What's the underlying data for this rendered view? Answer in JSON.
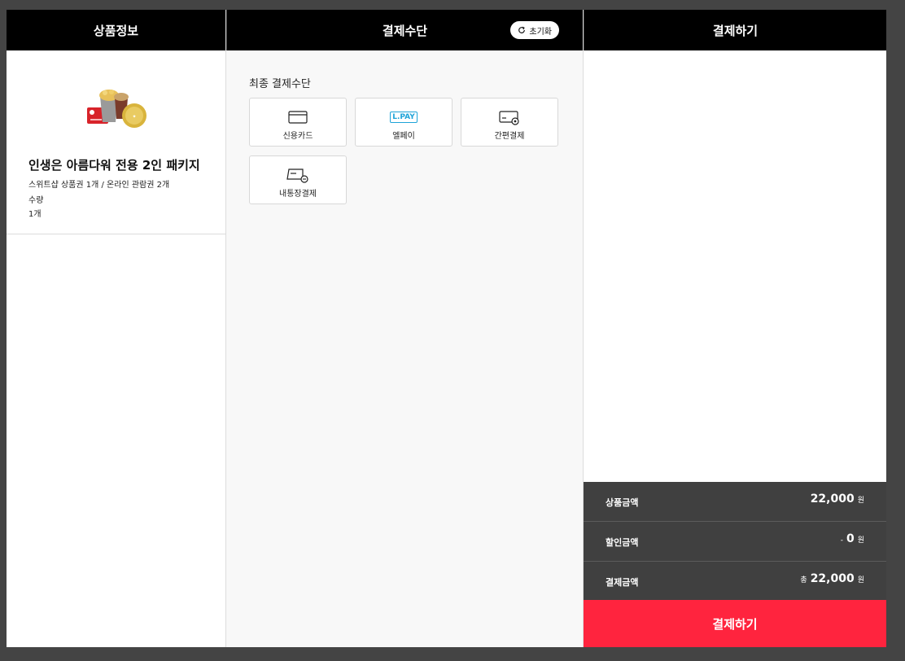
{
  "columns": {
    "product": {
      "title": "상품정보"
    },
    "method": {
      "title": "결제수단",
      "reset_label": "초기화"
    },
    "pay": {
      "title": "결제하기"
    }
  },
  "product": {
    "name": "인생은 아름다워 전용 2인 패키지",
    "description": "스위트샵 상품권 1개 / 온라인 관람권 2개",
    "quantity_label": "수량",
    "quantity_value": "1개"
  },
  "methods": {
    "title": "최종 결제수단",
    "items": [
      {
        "label": "신용카드",
        "icon": "credit-card-icon"
      },
      {
        "label": "엘페이",
        "icon": "lpay-logo-icon",
        "icon_text": "L.PAY"
      },
      {
        "label": "간편결제",
        "icon": "simple-pay-icon"
      },
      {
        "label": "내통장결제",
        "icon": "bank-account-icon"
      }
    ]
  },
  "summary": {
    "product_amount": {
      "label": "상품금액",
      "amount": "22,000",
      "unit": "원"
    },
    "discount_amount": {
      "label": "할인금액",
      "prefix": "-",
      "amount": "0",
      "unit": "원"
    },
    "payment_amount": {
      "label": "결제금액",
      "prefix": "총",
      "amount": "22,000",
      "unit": "원"
    }
  },
  "pay_button": {
    "label": "결제하기"
  },
  "colors": {
    "header_bg": "#000000",
    "summary_bg": "#404040",
    "pay_button": "#ff243e",
    "lpay_blue": "#1ea3d8",
    "page_bg": "#444444"
  }
}
